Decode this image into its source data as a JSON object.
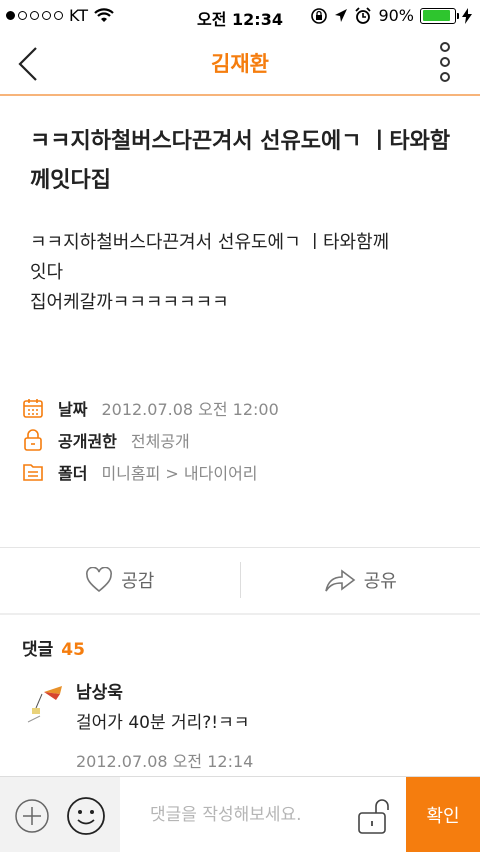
{
  "status_bar": {
    "carrier": "KT",
    "signal_full": 1,
    "signal_total": 5,
    "time": "오전 12:34",
    "battery": "90%",
    "battery_level": 0.9
  },
  "nav": {
    "title": "김재환",
    "back_icon": "chevron-left-icon",
    "more_icon": "vertical-dots-icon"
  },
  "post": {
    "title": "ㅋㅋ지하철버스다끈겨서 선유도에ㄱ ㅣ타와함께잇다집",
    "body": "ㅋㅋ지하철버스다끈겨서 선유도에ㄱ ㅣ타와함께\n잇다\n집어케갈까ㅋㅋㅋㅋㅋㅋㅋ",
    "meta": [
      {
        "icon": "calendar-icon",
        "label": "날짜",
        "value": "2012.07.08 오전 12:00"
      },
      {
        "icon": "lock-icon",
        "label": "공개권한",
        "value": "전체공개"
      },
      {
        "icon": "folder-icon",
        "label": "폴더",
        "value": "미니홈피 > 내다이어리"
      }
    ]
  },
  "actions": {
    "like_label": "공감",
    "share_label": "공유"
  },
  "comments": {
    "heading": "댓글",
    "count": "45",
    "items": [
      {
        "author": "남상욱",
        "text": "걸어가 40분 거리?!ㅋㅋ",
        "date": "2012.07.08  오전 12:14"
      }
    ]
  },
  "input_bar": {
    "placeholder": "댓글을 작성해보세요.",
    "confirm_label": "확인"
  },
  "colors": {
    "accent": "#f57d0e",
    "battery": "#2ec52e"
  }
}
